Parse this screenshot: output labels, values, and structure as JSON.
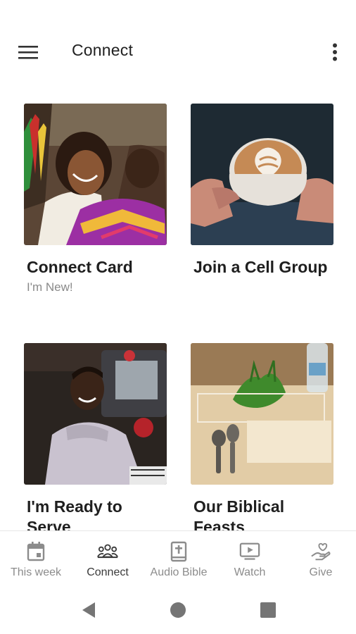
{
  "app_bar": {
    "title": "Connect",
    "menu_icon": "hamburger-menu-icon",
    "more_icon": "more-vert-icon"
  },
  "cards": [
    {
      "title": "Connect Card",
      "subtitle": "I'm New!",
      "image": "woman-smiling-photo"
    },
    {
      "title": "Join a Cell Group",
      "subtitle": "",
      "image": "latte-coffee-photo"
    },
    {
      "title": "I'm Ready to Serve",
      "subtitle": "",
      "image": "man-at-camera-photo"
    },
    {
      "title": "Our Biblical Feasts",
      "subtitle": "",
      "image": "table-setting-photo"
    }
  ],
  "bottom_nav": {
    "items": [
      {
        "label": "This week",
        "icon": "calendar-icon",
        "active": false
      },
      {
        "label": "Connect",
        "icon": "group-icon",
        "active": true
      },
      {
        "label": "Audio Bible",
        "icon": "bible-icon",
        "active": false
      },
      {
        "label": "Watch",
        "icon": "play-screen-icon",
        "active": false
      },
      {
        "label": "Give",
        "icon": "heart-hand-icon",
        "active": false
      }
    ]
  },
  "system_nav": {
    "back_icon": "back-triangle-icon",
    "home_icon": "home-circle-icon",
    "recents_icon": "recents-square-icon"
  },
  "colors": {
    "background": "#ffffff",
    "text_primary": "#1f1f1f",
    "text_secondary": "#8a8a8a",
    "nav_inactive": "#8c8c8c",
    "nav_active": "#3a3a3a"
  }
}
